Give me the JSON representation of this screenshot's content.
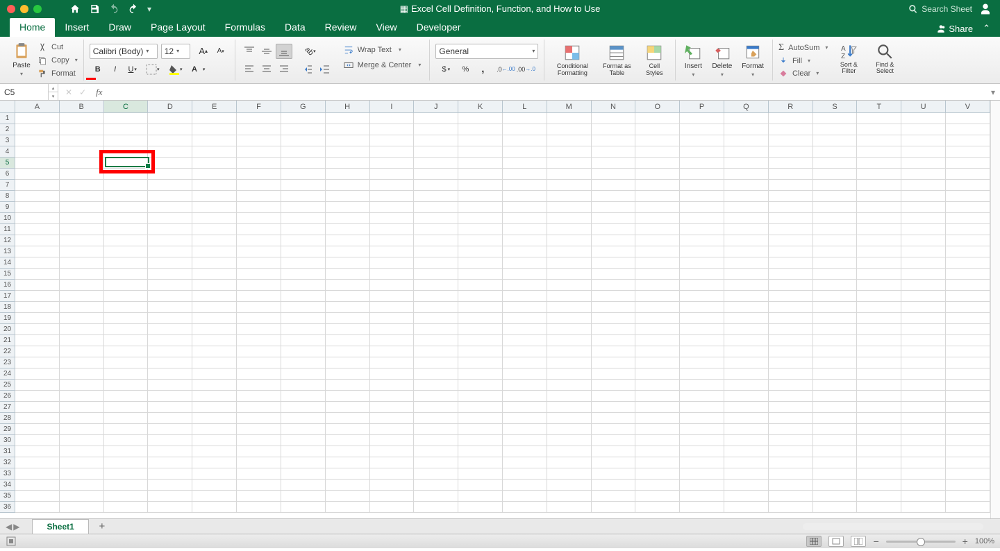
{
  "title": "Excel Cell Definition, Function, and How to Use",
  "search_placeholder": "Search Sheet",
  "share_label": "Share",
  "tabs": [
    "Home",
    "Insert",
    "Draw",
    "Page Layout",
    "Formulas",
    "Data",
    "Review",
    "View",
    "Developer"
  ],
  "active_tab": "Home",
  "clipboard": {
    "paste": "Paste",
    "cut": "Cut",
    "copy": "Copy",
    "format": "Format"
  },
  "font": {
    "name": "Calibri (Body)",
    "size": "12"
  },
  "alignment": {
    "wrap": "Wrap Text",
    "merge": "Merge & Center"
  },
  "number": {
    "format": "General"
  },
  "styles": {
    "cond": "Conditional Formatting",
    "table": "Format as Table",
    "cell": "Cell Styles"
  },
  "cells_group": {
    "insert": "Insert",
    "delete": "Delete",
    "format": "Format"
  },
  "editing": {
    "autosum": "AutoSum",
    "fill": "Fill",
    "clear": "Clear",
    "sort": "Sort & Filter",
    "find": "Find & Select"
  },
  "name_box": "C5",
  "columns": [
    "A",
    "B",
    "C",
    "D",
    "E",
    "F",
    "G",
    "H",
    "I",
    "J",
    "K",
    "L",
    "M",
    "N",
    "O",
    "P",
    "Q",
    "R",
    "S",
    "T",
    "U",
    "V"
  ],
  "rows": [
    1,
    2,
    3,
    4,
    5,
    6,
    7,
    8,
    9,
    10,
    11,
    12,
    13,
    14,
    15,
    16,
    17,
    18,
    19,
    20,
    21,
    22,
    23,
    24,
    25,
    26,
    27,
    28,
    29,
    30,
    31,
    32,
    33,
    34,
    35,
    36
  ],
  "selected_cell": {
    "col": 2,
    "row": 4
  },
  "sheet_tab": "Sheet1",
  "zoom": "100%"
}
